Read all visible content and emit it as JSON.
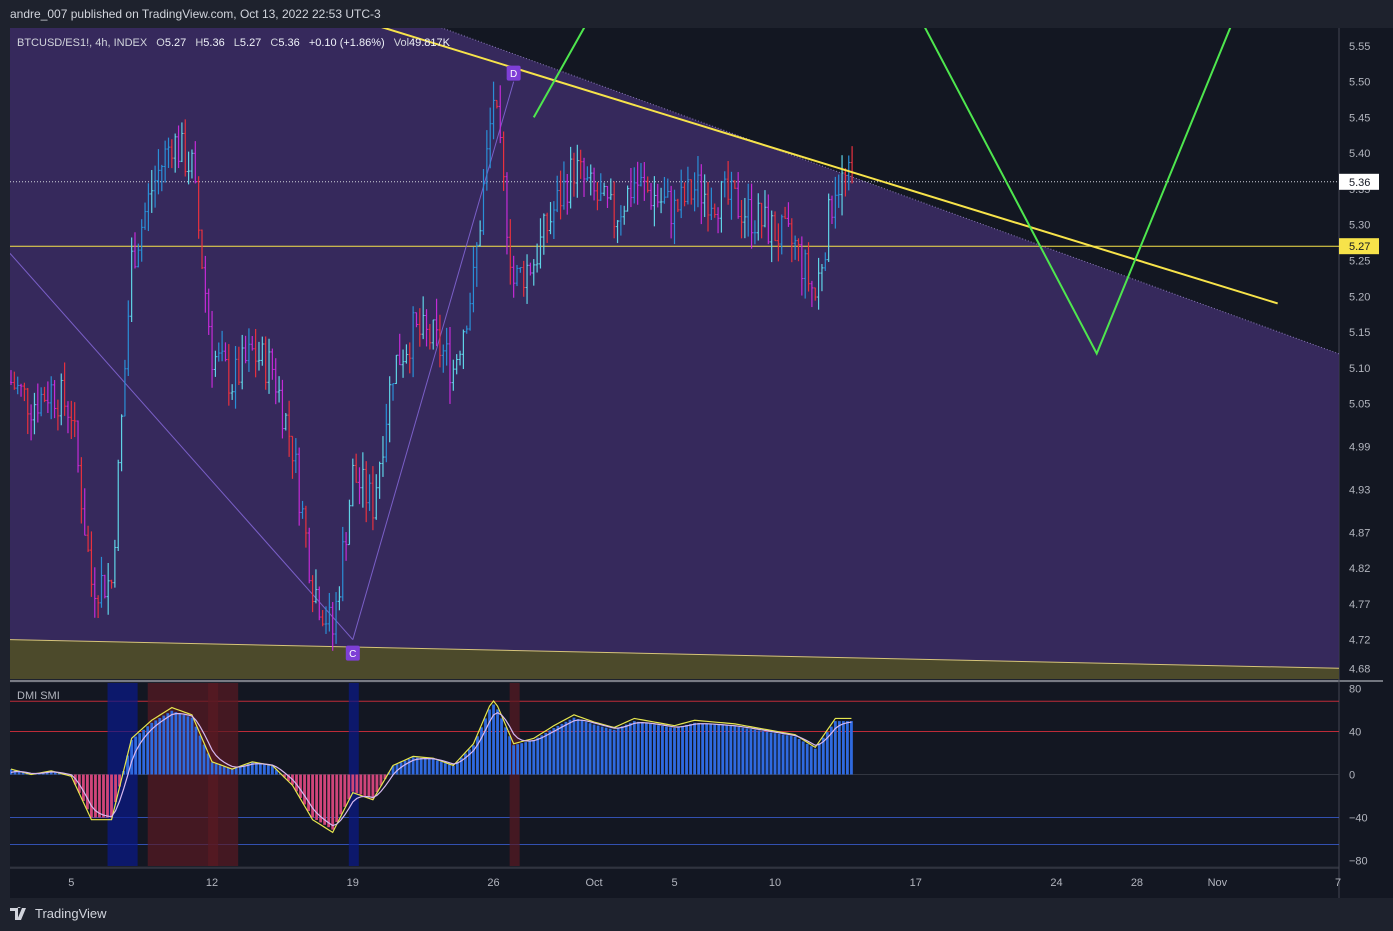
{
  "header": {
    "publisher_text": "andre_007 published on TradingView.com, Oct 13, 2022 22:53 UTC-3"
  },
  "footer": {
    "brand": "TradingView"
  },
  "legend": {
    "symbol": "BTCUSD/ES1!, 4h, INDEX",
    "o_label": "O",
    "o_value": "5.27",
    "h_label": "H",
    "h_value": "5.36",
    "l_label": "L",
    "l_value": "5.27",
    "c_label": "C",
    "c_value": "5.36",
    "change": "+0.10 (+1.86%)",
    "vol_label": "Vol",
    "vol_value": "49.817K"
  },
  "indicator": {
    "title": "DMI SMI"
  },
  "price_badges": [
    {
      "value": "5.36",
      "price": 5.36,
      "bg": "#ffffff",
      "fg": "#131722"
    },
    {
      "value": "5.27",
      "price": 5.27,
      "bg": "#f7e34a",
      "fg": "#131722"
    }
  ],
  "points": [
    {
      "label": "D",
      "date": "2022-09-27",
      "price": 5.5
    },
    {
      "label": "C",
      "date": "2022-09-19",
      "price": 4.72
    }
  ],
  "colors": {
    "background": "#131722",
    "channel_fill": "#3b2b63",
    "support_zone": "#4c4a2b",
    "trendline": "#f7e34a",
    "projection": "#4ee64e",
    "candle_up": "#2a8fd6",
    "candle_down": "#e8313e",
    "candle_mid": "#c42bd6",
    "hist_up": "#2f6ae0",
    "hist_down": "#d1457a",
    "point_marker": "#7e3fd6"
  },
  "chart_data": [
    {
      "type": "candlestick",
      "title": "BTCUSD/ES1!, 4h, INDEX",
      "x_axis": {
        "ticks": [
          "5",
          "12",
          "19",
          "26",
          "Oct",
          "5",
          "10",
          "17",
          "24",
          "28",
          "Nov",
          "7"
        ],
        "range": [
          "2022-09-02",
          "2022-11-07"
        ]
      },
      "y_axis": {
        "ticks": [
          5.55,
          5.5,
          5.45,
          5.4,
          5.35,
          5.3,
          5.25,
          5.2,
          5.15,
          5.1,
          5.05,
          4.99,
          4.93,
          4.87,
          4.82,
          4.77,
          4.72,
          4.68
        ],
        "range": [
          4.665,
          5.575
        ]
      },
      "series": [
        {
          "x": [
            "2022-09-02",
            "2022-09-03",
            "2022-09-04",
            "2022-09-05",
            "2022-09-06",
            "2022-09-07",
            "2022-09-08",
            "2022-09-09",
            "2022-09-10",
            "2022-09-11",
            "2022-09-12",
            "2022-09-13",
            "2022-09-14",
            "2022-09-15",
            "2022-09-16",
            "2022-09-17",
            "2022-09-18",
            "2022-09-19",
            "2022-09-20",
            "2022-09-21",
            "2022-09-22",
            "2022-09-23",
            "2022-09-24",
            "2022-09-25",
            "2022-09-26",
            "2022-09-27",
            "2022-09-28",
            "2022-09-29",
            "2022-09-30",
            "2022-10-01",
            "2022-10-02",
            "2022-10-03",
            "2022-10-04",
            "2022-10-05",
            "2022-10-06",
            "2022-10-07",
            "2022-10-08",
            "2022-10-09",
            "2022-10-10",
            "2022-10-11",
            "2022-10-12",
            "2022-10-13"
          ],
          "close": [
            5.08,
            5.05,
            5.07,
            5.04,
            4.8,
            4.8,
            5.25,
            5.35,
            5.42,
            5.38,
            5.12,
            5.08,
            5.12,
            5.1,
            4.99,
            4.8,
            4.73,
            4.95,
            4.91,
            5.1,
            5.15,
            5.14,
            5.1,
            5.22,
            5.48,
            5.22,
            5.25,
            5.32,
            5.38,
            5.34,
            5.31,
            5.36,
            5.34,
            5.32,
            5.35,
            5.34,
            5.33,
            5.31,
            5.29,
            5.27,
            5.2,
            5.36
          ]
        }
      ],
      "overlays": {
        "channel_top": [
          {
            "x": "2022-09-21",
            "y": 5.6
          },
          {
            "x": "2022-11-07",
            "y": 5.12
          }
        ],
        "channel_bottom": [
          {
            "x": "2022-09-02",
            "y": 4.72
          },
          {
            "x": "2022-11-07",
            "y": 4.68
          }
        ],
        "descending_trendline": [
          {
            "x": "2022-09-20",
            "y": 5.58
          },
          {
            "x": "2022-11-04",
            "y": 5.19
          }
        ],
        "horizontal_close_line": 5.36,
        "horizontal_open_line": 5.27,
        "projection_path": [
          {
            "x": "2022-09-28",
            "y": 5.45
          },
          {
            "x": "2022-10-01",
            "y": 5.6
          },
          {
            "x": "2022-10-17",
            "y": 5.6
          },
          {
            "x": "2022-10-26",
            "y": 5.12
          },
          {
            "x": "2022-11-02",
            "y": 5.6
          }
        ]
      }
    },
    {
      "type": "bar",
      "title": "DMI SMI",
      "y_axis": {
        "ticks": [
          80,
          40,
          0,
          -40,
          -80
        ],
        "range": [
          -85,
          85
        ]
      },
      "levels": [
        68,
        40,
        0,
        -40,
        -65
      ]
    }
  ]
}
